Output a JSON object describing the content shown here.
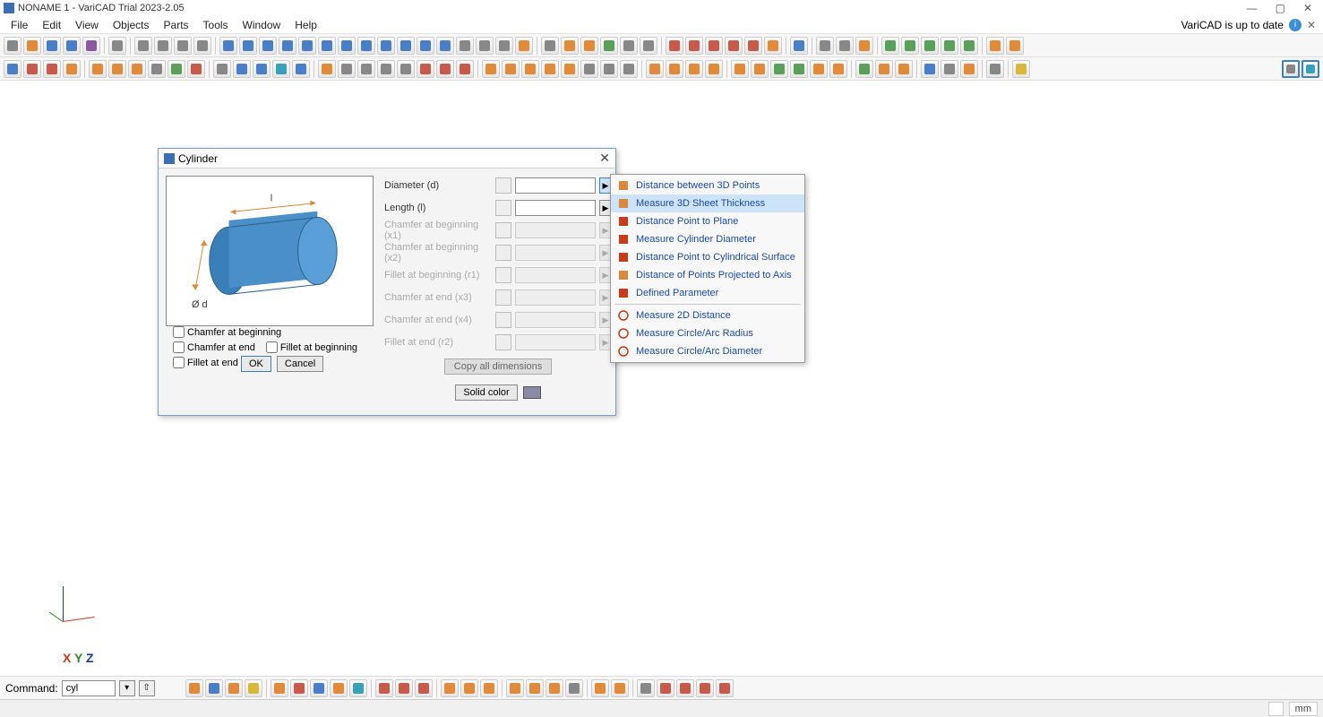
{
  "title": "NONAME 1 - VariCAD Trial 2023-2.05",
  "menu": [
    "File",
    "Edit",
    "View",
    "Objects",
    "Parts",
    "Tools",
    "Window",
    "Help"
  ],
  "status_right": "VariCAD is up to date",
  "dialog": {
    "title": "Cylinder",
    "fields": [
      {
        "label": "Diameter (d)",
        "enabled": true,
        "highlight": true
      },
      {
        "label": "Length (l)",
        "enabled": true,
        "highlight": false
      },
      {
        "label": "Chamfer at beginning (x1)",
        "enabled": false,
        "highlight": false
      },
      {
        "label": "Chamfer at beginning (x2)",
        "enabled": false,
        "highlight": false
      },
      {
        "label": "Fillet at beginning (r1)",
        "enabled": false,
        "highlight": false
      },
      {
        "label": "Chamfer at end (x3)",
        "enabled": false,
        "highlight": false
      },
      {
        "label": "Chamfer at end (x4)",
        "enabled": false,
        "highlight": false
      },
      {
        "label": "Fillet at end (r2)",
        "enabled": false,
        "highlight": false
      }
    ],
    "checks": {
      "chamfer_begin": "Chamfer at beginning",
      "chamfer_end": "Chamfer at end",
      "fillet_begin": "Fillet at beginning",
      "fillet_end": "Fillet at end"
    },
    "ok": "OK",
    "cancel": "Cancel",
    "copy": "Copy all dimensions",
    "solid": "Solid color",
    "preview_labels": {
      "l": "l",
      "d": "Ø d"
    }
  },
  "ctxmenu": {
    "items_top": [
      "Distance between 3D Points",
      "Measure 3D Sheet Thickness",
      "Distance Point to Plane",
      "Measure Cylinder Diameter",
      "Distance Point to Cylindrical Surface",
      "Distance of Points Projected to Axis",
      "Defined Parameter"
    ],
    "items_bottom": [
      "Measure 2D Distance",
      "Measure Circle/Arc Radius",
      "Measure Circle/Arc Diameter"
    ],
    "hovered_index": 1
  },
  "command": {
    "label": "Command:",
    "value": "cyl"
  },
  "axes_labels": {
    "x": "X",
    "y": "Y",
    "z": "Z"
  },
  "status_unit": "mm"
}
